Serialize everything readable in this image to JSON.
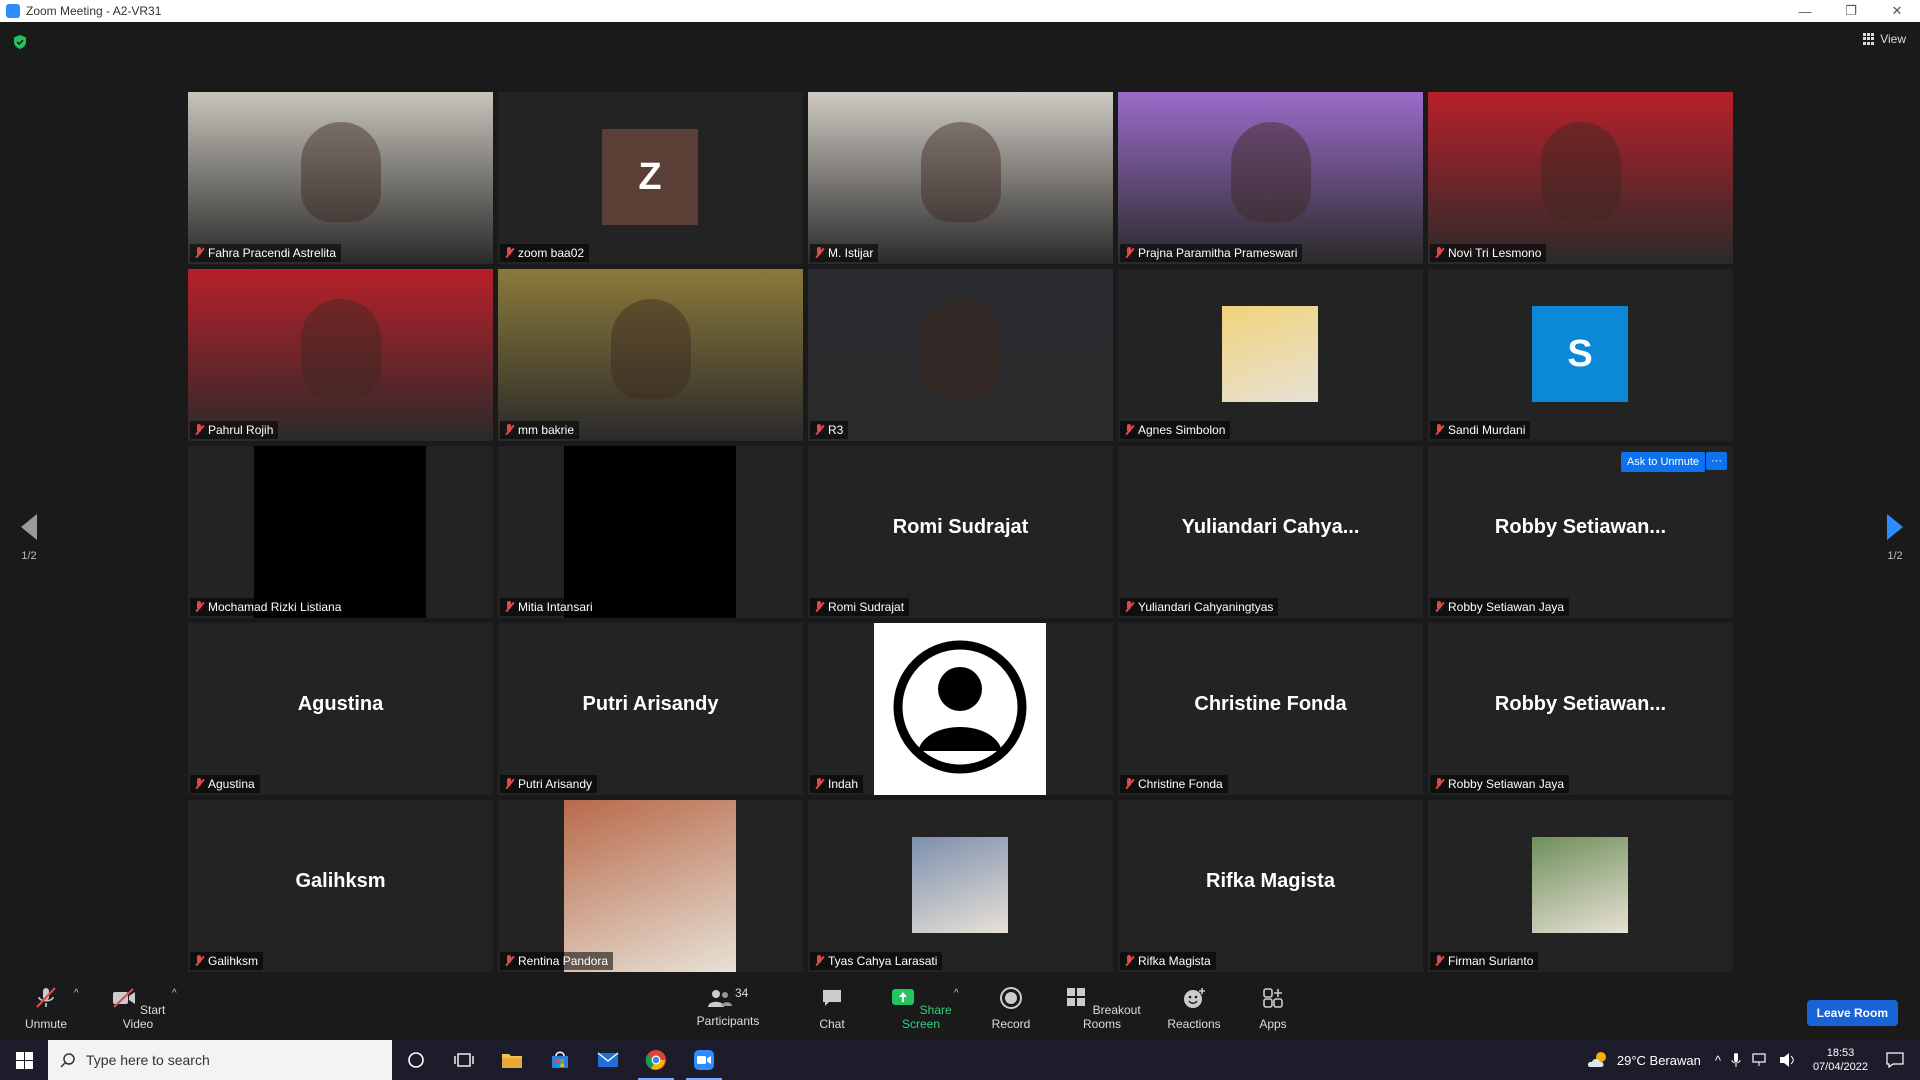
{
  "window": {
    "title": "Zoom Meeting - A2-VR31",
    "minimize": "—",
    "restore": "❐",
    "close": "✕"
  },
  "view_label": "View",
  "pager": {
    "left": "1/2",
    "right": "1/2"
  },
  "tiles": [
    {
      "name": "Fahra Pracendi Astrelita",
      "type": "video",
      "bg": "#c8c4bc"
    },
    {
      "name": "zoom baa02",
      "type": "letter",
      "letter": "Z",
      "letter_bg": "#5b3f36"
    },
    {
      "name": "M. Istijar",
      "type": "video",
      "bg": "#cfcac3"
    },
    {
      "name": "Prajna Paramitha Prameswari",
      "type": "video",
      "bg": "#9a6cc9"
    },
    {
      "name": "Novi Tri Lesmono",
      "type": "video",
      "bg": "#b8202a"
    },
    {
      "name": "Pahrul Rojih",
      "type": "video",
      "bg": "#b8202a"
    },
    {
      "name": "mm bakrie",
      "type": "video",
      "bg": "#8a7a3a"
    },
    {
      "name": "R3",
      "type": "video",
      "bg": "#2a2a30",
      "active": true
    },
    {
      "name": "Agnes Simbolon",
      "type": "image",
      "bg": "#f1d37a"
    },
    {
      "name": "Sandi Murdani",
      "type": "letter",
      "letter": "S",
      "letter_bg": "#0b88d8"
    },
    {
      "name": "Mochamad Rizki Listiana",
      "type": "black"
    },
    {
      "name": "Mitia Intansari",
      "type": "black"
    },
    {
      "name": "Romi Sudrajat",
      "type": "text",
      "display": "Romi Sudrajat"
    },
    {
      "name": "Yuliandari Cahyaningtyas",
      "type": "text",
      "display": "Yuliandari  Cahya..."
    },
    {
      "name": "Robby Setiawan Jaya",
      "type": "text",
      "display": "Robby  Setiawan...",
      "ask_unmute": "Ask to Unmute",
      "more": "···"
    },
    {
      "name": "Agustina",
      "type": "text",
      "display": "Agustina"
    },
    {
      "name": "Putri Arisandy",
      "type": "text",
      "display": "Putri Arisandy"
    },
    {
      "name": "Indah",
      "type": "profile"
    },
    {
      "name": "Christine Fonda",
      "type": "text",
      "display": "Christine Fonda"
    },
    {
      "name": "Robby Setiawan Jaya",
      "type": "text",
      "display": "Robby  Setiawan..."
    },
    {
      "name": "Galihksm",
      "type": "text",
      "display": "Galihksm"
    },
    {
      "name": "Rentina Pandora",
      "type": "image",
      "bg": "#b86a4a",
      "wide": true
    },
    {
      "name": "Tyas Cahya Larasati",
      "type": "image",
      "bg": "#7d8fae"
    },
    {
      "name": "Rifka Magista",
      "type": "text",
      "display": "Rifka Magista"
    },
    {
      "name": "Firman Surianto",
      "type": "image",
      "bg": "#6f8f5a"
    }
  ],
  "toolbar": {
    "unmute": "Unmute",
    "start_video": "Start Video",
    "participants": "Participants",
    "participants_count": "34",
    "chat": "Chat",
    "share_screen": "Share Screen",
    "record": "Record",
    "breakout_rooms": "Breakout Rooms",
    "reactions": "Reactions",
    "apps": "Apps",
    "leave_room": "Leave Room"
  },
  "taskbar": {
    "search_placeholder": "Type here to search",
    "weather": "29°C  Berawan",
    "time": "18:53",
    "date": "07/04/2022"
  }
}
